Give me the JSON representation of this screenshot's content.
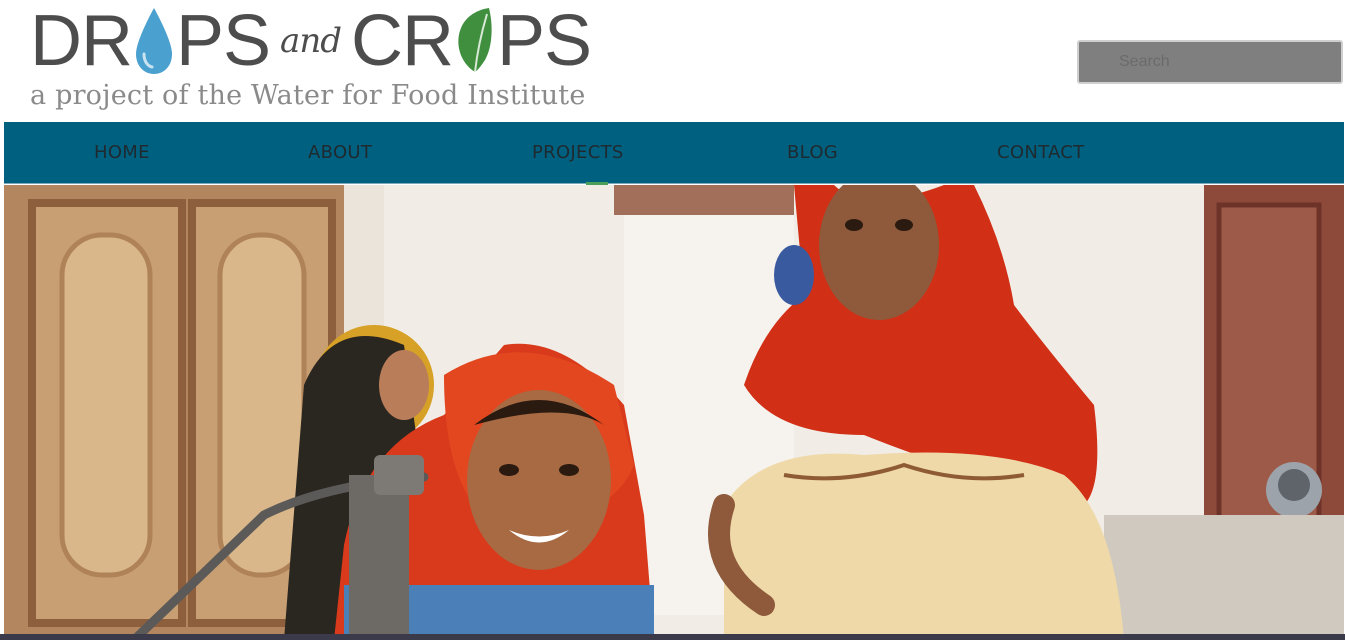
{
  "logo": {
    "word1_a": "DR",
    "word1_b": "PS",
    "connector": "and",
    "word2_a": "CR",
    "word2_b": "PS",
    "tagline": "a project of the Water for Food Institute",
    "drop_icon": "water-drop-icon",
    "leaf_icon": "leaf-icon",
    "drop_color": "#4aa0cf",
    "leaf_color": "#3f8f3e"
  },
  "search": {
    "placeholder": "Search",
    "value": ""
  },
  "nav": {
    "color": "#00607f",
    "items": [
      {
        "label": "HOME"
      },
      {
        "label": "ABOUT"
      },
      {
        "label": "PROJECTS"
      },
      {
        "label": "BLOG"
      },
      {
        "label": "CONTACT"
      }
    ],
    "active": "PROJECTS"
  },
  "hero": {
    "image": "photo of smiling girls in red headscarves at a hand water pump"
  }
}
